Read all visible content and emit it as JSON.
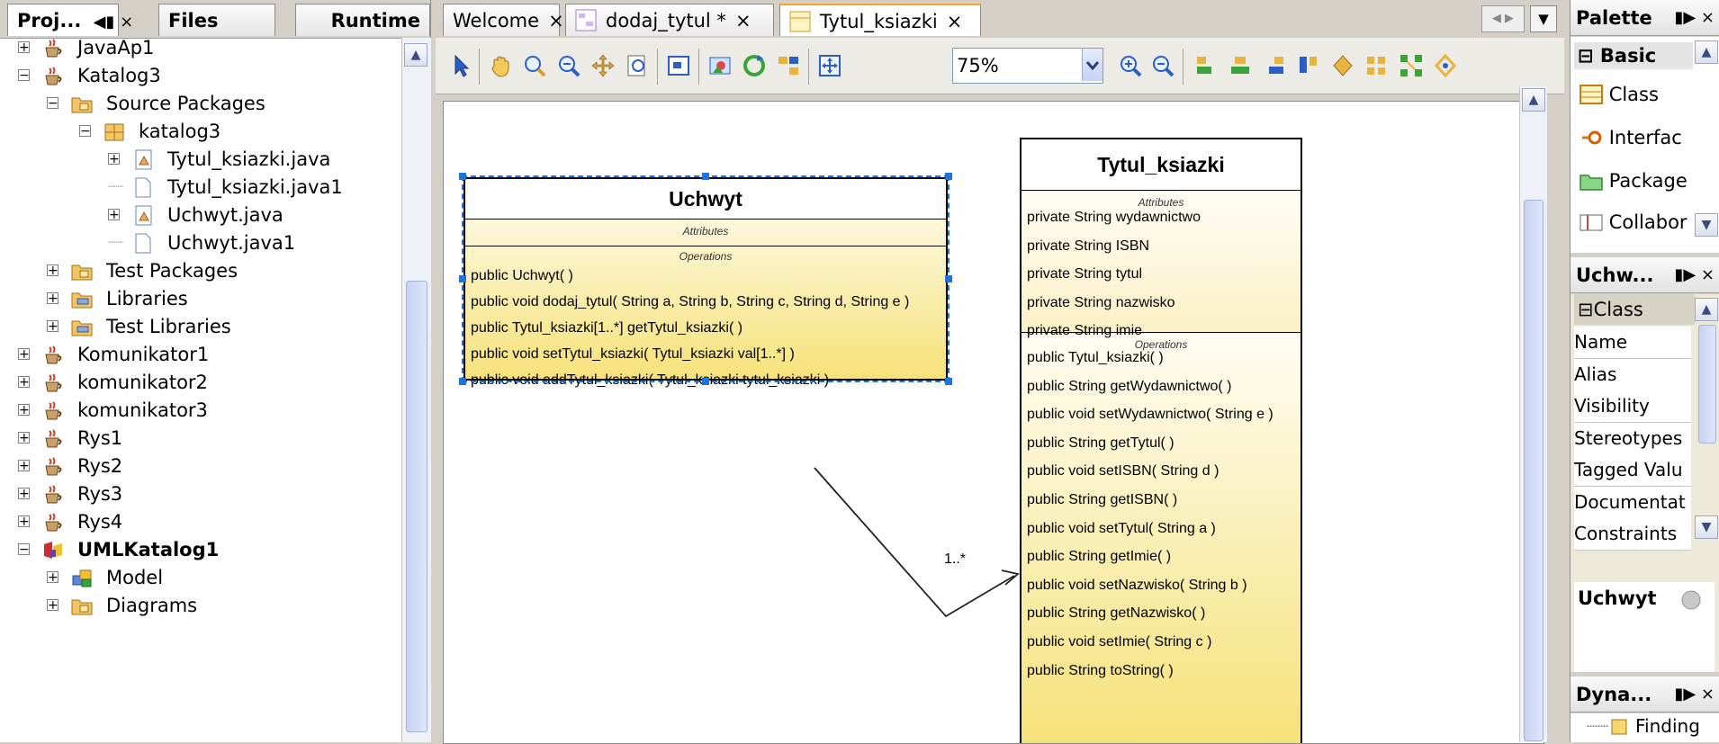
{
  "left_panel": {
    "tabs": [
      {
        "label": "Proj...",
        "controls": "◀▮ ×"
      },
      {
        "label": "Files"
      },
      {
        "label": "Runtime"
      }
    ],
    "tree": [
      {
        "label": "JavaAp1"
      },
      {
        "label": "Katalog3"
      },
      {
        "label": "Source Packages"
      },
      {
        "label": "katalog3"
      },
      {
        "label": "Tytul_ksiazki.java"
      },
      {
        "label": "Tytul_ksiazki.java1"
      },
      {
        "label": "Uchwyt.java"
      },
      {
        "label": "Uchwyt.java1"
      },
      {
        "label": "Test Packages"
      },
      {
        "label": "Libraries"
      },
      {
        "label": "Test Libraries"
      },
      {
        "label": "Komunikator1"
      },
      {
        "label": "komunikator2"
      },
      {
        "label": "komunikator3"
      },
      {
        "label": "Rys1"
      },
      {
        "label": "Rys2"
      },
      {
        "label": "Rys3"
      },
      {
        "label": "Rys4"
      },
      {
        "label": "UMLKatalog1"
      },
      {
        "label": "Model"
      },
      {
        "label": "Diagrams"
      }
    ]
  },
  "editor": {
    "tabs": [
      {
        "label": "Welcome",
        "close": "×"
      },
      {
        "label": "dodaj_tytul *",
        "close": "×"
      },
      {
        "label": "Tytul_ksiazki",
        "close": "×"
      }
    ],
    "zoom": "75%",
    "colors": {
      "selection": "#1b75e0",
      "class_fill_bottom": "#f6e27a",
      "active_tab_accent": "#f5a623"
    }
  },
  "diagram": {
    "uchwyt": {
      "name": "Uchwyt",
      "attributes_header": "Attributes",
      "operations_header": "Operations",
      "operations": [
        "public Uchwyt( )",
        "public void  dodaj_tytul( String a, String b, String c, String d, String e )",
        "public Tytul_ksiazki[1..*]  getTytul_ksiazki( )",
        "public void  setTytul_ksiazki( Tytul_ksiazki val[1..*] )",
        "public void  addTytul_ksiazki( Tytul_ksiazki tytul_ksiazki )"
      ]
    },
    "tytul": {
      "name": "Tytul_ksiazki",
      "attributes_header": "Attributes",
      "attributes": [
        "private String wydawnictwo",
        "private String ISBN",
        "private String tytul",
        "private String nazwisko",
        "private String imie"
      ],
      "operations_header": "Operations",
      "operations": [
        "public Tytul_ksiazki( )",
        "public String  getWydawnictwo( )",
        "public void  setWydawnictwo( String e )",
        "public String  getTytul( )",
        "public void  setISBN( String d )",
        "public String  getISBN( )",
        "public void  setTytul( String a )",
        "public String  getImie( )",
        "public void  setNazwisko( String b )",
        "public String  getNazwisko( )",
        "public void  setImie( String c )",
        "public String  toString( )"
      ]
    },
    "multiplicity": "1..*"
  },
  "right_panel": {
    "palette": {
      "title": "Palette",
      "section": "Basic",
      "items": [
        "Class",
        "Interfac",
        "Package",
        "Collabor"
      ]
    },
    "properties": {
      "title": "Uchw...",
      "section": "Class",
      "rows": [
        "Name",
        "Alias",
        "Visibility",
        "Stereotypes",
        "Tagged Valu",
        "Documentat",
        "Constraints"
      ],
      "selected_name": "Uchwyt"
    },
    "dynamic": {
      "title": "Dyna...",
      "item": "Finding"
    },
    "panel_controls": "▮▶ ×"
  }
}
